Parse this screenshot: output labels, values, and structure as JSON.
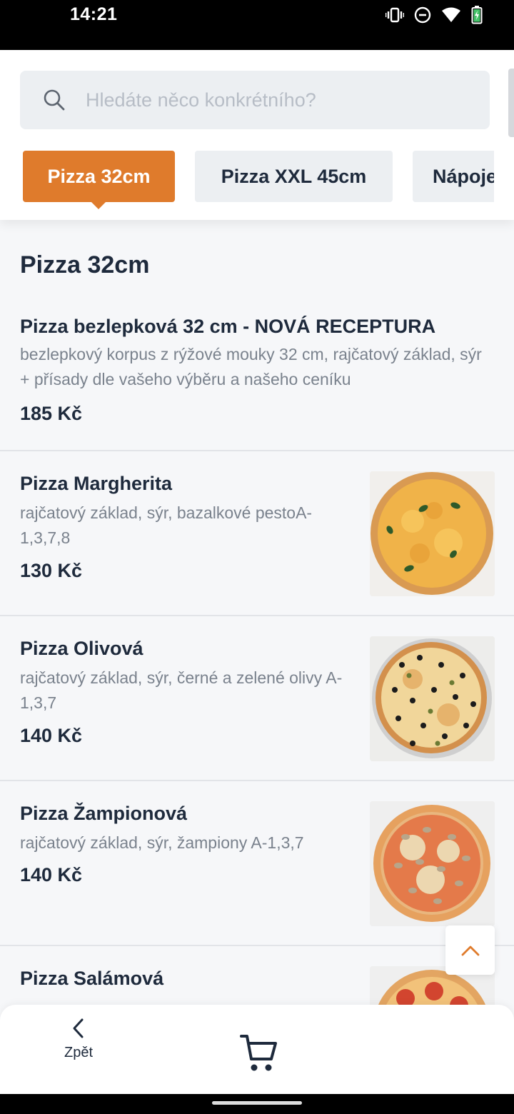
{
  "status_bar": {
    "time": "14:21"
  },
  "search": {
    "placeholder": "Hledáte něco konkrétního?"
  },
  "tabs": [
    {
      "label": "Pizza 32cm",
      "active": true
    },
    {
      "label": "Pizza XXL 45cm",
      "active": false
    },
    {
      "label": "Nápoje",
      "active": false
    }
  ],
  "section": {
    "title": "Pizza 32cm"
  },
  "items": [
    {
      "name": "Pizza bezlepková 32 cm - NOVÁ RECEPTURA",
      "description": "bezlepkový korpus z rýžové mouky 32 cm, rajčatový základ, sýr + přísady dle vašeho výběru a našeho ceníku",
      "price": "185 Kč"
    },
    {
      "name": "Pizza Margherita",
      "description": "rajčatový základ, sýr, bazalkové pestoA-1,3,7,8",
      "price": "130 Kč",
      "image": "pizza-margherita-image"
    },
    {
      "name": "Pizza Olivová",
      "description": "rajčatový základ, sýr, černé a zelené olivy A-1,3,7",
      "price": "140 Kč",
      "image": "pizza-olive-image"
    },
    {
      "name": "Pizza Žampionová",
      "description": "rajčatový základ, sýr, žampiony A-1,3,7",
      "price": "140 Kč",
      "image": "pizza-mushroom-image"
    },
    {
      "name": "Pizza Salámová",
      "description": "",
      "price": "",
      "image": "pizza-salami-image"
    }
  ],
  "bottom_nav": {
    "back_label": "Zpět",
    "cart_icon": "cart-icon",
    "back_icon": "chevron-left-icon"
  },
  "colors": {
    "accent": "#df7b2c",
    "text": "#1e2a3c",
    "muted": "#7a828d",
    "surface": "#eceff2"
  }
}
